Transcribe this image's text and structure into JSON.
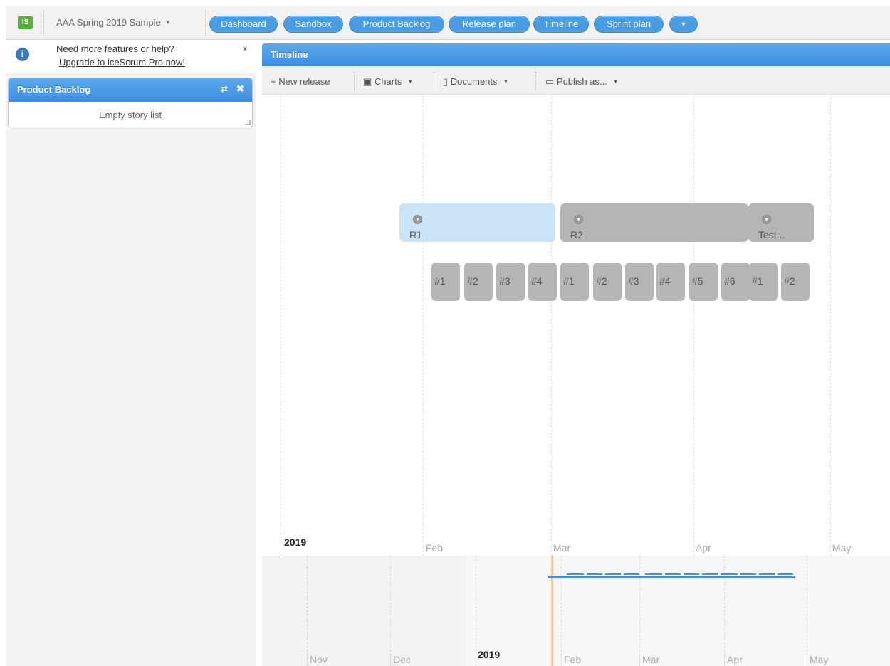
{
  "topbar": {
    "logo": "IS",
    "project": "AAA Spring 2019 Sample",
    "nav": [
      {
        "label": "Dashboard"
      },
      {
        "label": "Sandbox"
      },
      {
        "label": "Product Backlog"
      },
      {
        "label": "Release plan"
      },
      {
        "label": "Timeline"
      },
      {
        "label": "Sprint plan"
      }
    ],
    "more_glyph": "▼"
  },
  "notice": {
    "text": "Need more features or help?",
    "link": "Upgrade to iceScrum Pro now!",
    "close": "x"
  },
  "product_backlog": {
    "title": "Product Backlog",
    "swap_glyph": "⇄",
    "close_glyph": "✖",
    "empty_text": "Empty story list"
  },
  "timeline": {
    "title": "Timeline",
    "toolbar": {
      "new_release": "+ New release",
      "charts": "Charts",
      "documents": "Documents",
      "publish": "Publish as..."
    },
    "releases": [
      {
        "name": "R1",
        "state": "active",
        "color": "#c9e3f8"
      },
      {
        "name": "R2",
        "state": "todo",
        "color": "#b5b5b5"
      },
      {
        "name": "Test...",
        "state": "todo",
        "color": "#b5b5b5"
      }
    ],
    "sprints": [
      {
        "label": "#1"
      },
      {
        "label": "#2"
      },
      {
        "label": "#3"
      },
      {
        "label": "#4"
      },
      {
        "label": "#1"
      },
      {
        "label": "#2"
      },
      {
        "label": "#3"
      },
      {
        "label": "#4"
      },
      {
        "label": "#5"
      },
      {
        "label": "#6"
      },
      {
        "label": "#1"
      },
      {
        "label": "#2"
      }
    ],
    "axis": {
      "year": "2019",
      "months": [
        "Feb",
        "Mar",
        "Apr",
        "May"
      ]
    },
    "overview": {
      "months_before": [
        "Nov",
        "Dec"
      ],
      "year": "2019",
      "months_after": [
        "Feb",
        "Mar",
        "Apr",
        "May"
      ]
    }
  },
  "colors": {
    "accent": "#4a9de0",
    "active_release": "#c9e3f8",
    "inactive": "#b5b5b5",
    "logo": "#55b13a"
  }
}
